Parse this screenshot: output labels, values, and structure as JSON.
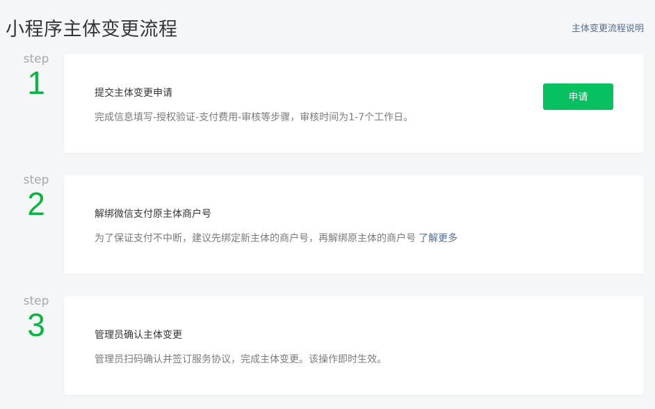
{
  "header": {
    "title": "小程序主体变更流程",
    "help_link": "主体变更流程说明"
  },
  "steps": [
    {
      "label": "step",
      "number": "1",
      "title": "提交主体变更申请",
      "description": "完成信息填写-授权验证-支付费用-审核等步骤，审核时间为1-7个工作日。",
      "button_label": "申请"
    },
    {
      "label": "step",
      "number": "2",
      "title": "解绑微信支付原主体商户号",
      "description": "为了保证支付不中断，建议先绑定新主体的商户号，再解绑原主体的商户号",
      "link_label": "了解更多"
    },
    {
      "label": "step",
      "number": "3",
      "title": "管理员确认主体变更",
      "description": "管理员扫码确认并签订服务协议，完成主体变更。该操作即时生效。"
    }
  ],
  "colors": {
    "accent_green": "#07c160",
    "step_number_green": "#07b53f",
    "link_blue": "#576b95",
    "background": "#f4f6f8"
  }
}
